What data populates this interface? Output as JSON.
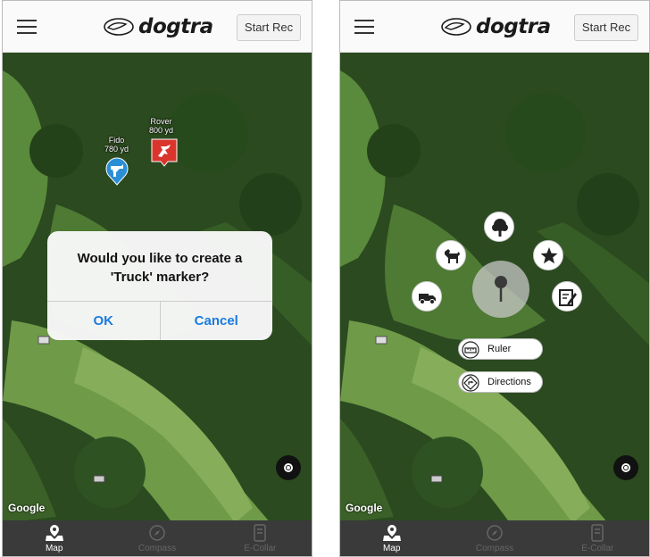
{
  "app": {
    "logo_text": "dogtra",
    "start_rec_label": "Start Rec"
  },
  "map": {
    "attribution": "Google"
  },
  "tabs": [
    {
      "label": "Map",
      "icon": "map-pin-icon",
      "active": true
    },
    {
      "label": "Compass",
      "icon": "compass-icon",
      "active": false
    },
    {
      "label": "E-Collar",
      "icon": "e-collar-icon",
      "active": false
    }
  ],
  "left_screen": {
    "dogs": [
      {
        "name": "Fido",
        "distance": "780 yd",
        "color": "#2b8fd6"
      },
      {
        "name": "Rover",
        "distance": "800 yd",
        "color": "#d9352d"
      }
    ],
    "dialog": {
      "message": "Would you like to create a 'Truck' marker?",
      "ok_label": "OK",
      "cancel_label": "Cancel"
    }
  },
  "right_screen": {
    "marker_options": [
      "tree-icon",
      "dog-icon",
      "star-icon",
      "truck-icon",
      "note-icon"
    ],
    "actions": {
      "ruler_label": "Ruler",
      "directions_label": "Directions"
    }
  },
  "colors": {
    "accent": "#1a7be0",
    "tabbar": "#3a3a3a"
  }
}
